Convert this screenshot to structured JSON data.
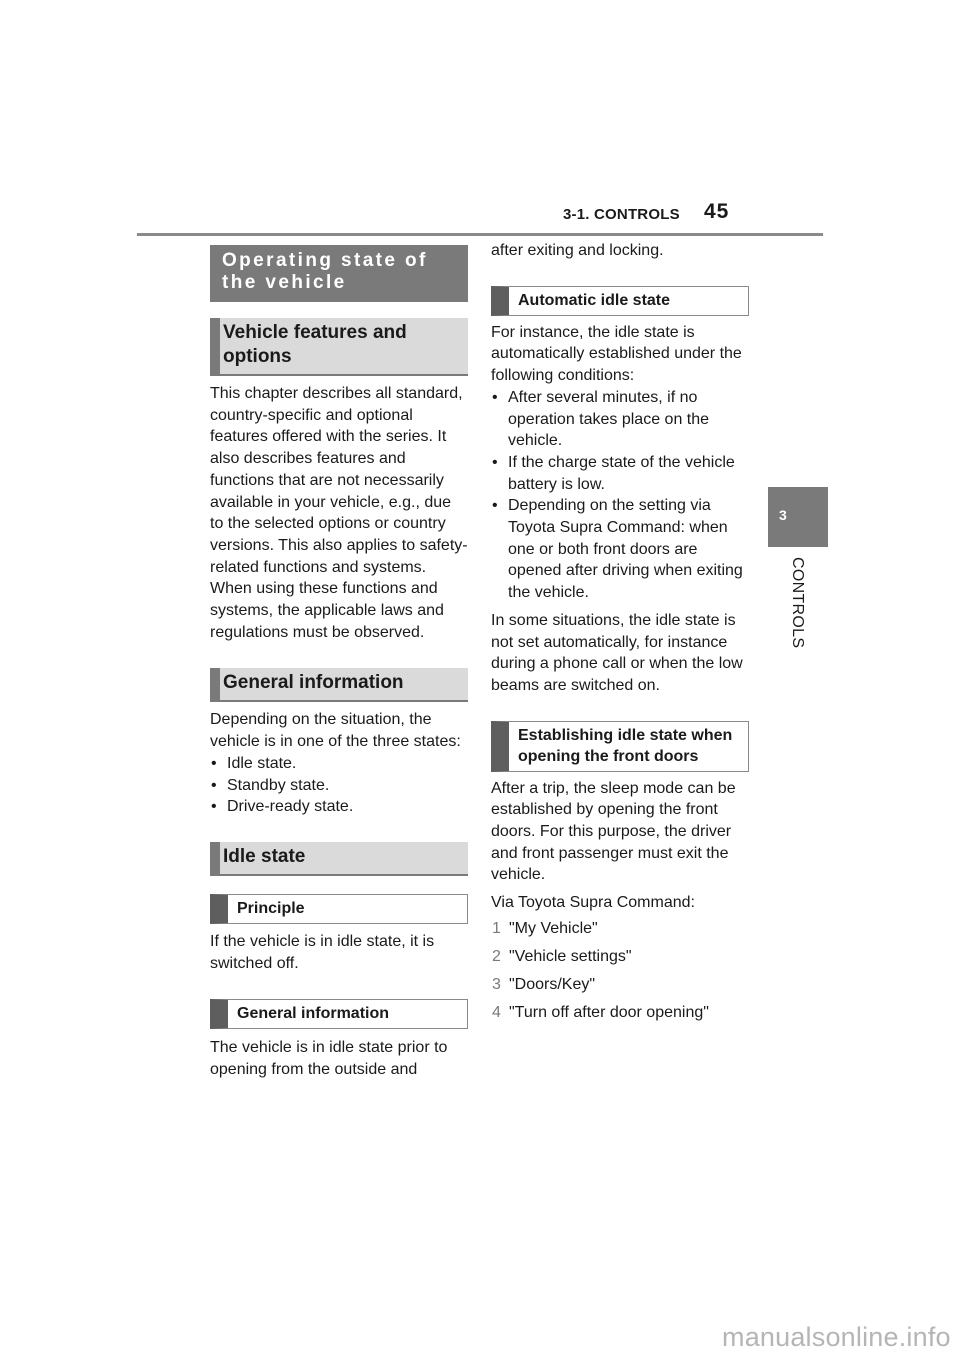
{
  "header": {
    "section": "3-1. CONTROLS",
    "page_number": "45"
  },
  "side_tab": {
    "chapter_number": "3",
    "chapter_label": "CONTROLS"
  },
  "left_column": {
    "title": "Operating state of the vehicle",
    "features_heading": "Vehicle features and options",
    "features_text": "This chapter describes all standard, country-specific and optional features offered with the series. It also describes features and functions that are not necessarily available in your vehicle, e.g., due to the selected options or country versions. This also applies to safety-related functions and systems. When using these functions and systems, the applicable laws and regulations must be observed.",
    "general_heading": "General information",
    "general_text": "Depending on the situation, the vehicle is in one of the three states:",
    "states": [
      "Idle state.",
      "Standby state.",
      "Drive-ready state."
    ],
    "idle_heading": "Idle state",
    "principle_heading": "Principle",
    "principle_text": "If the vehicle is in idle state, it is switched off.",
    "idle_general_heading": "General information",
    "idle_general_text": "The vehicle is in idle state prior to opening from the outside and"
  },
  "right_column": {
    "continued_text": "after exiting and locking.",
    "auto_heading": "Automatic idle state",
    "auto_intro": "For instance, the idle state is automatically established under the following conditions:",
    "auto_conditions": [
      "After several minutes, if no operation takes place on the vehicle.",
      "If the charge state of the vehicle battery is low.",
      "Depending on the setting via Toyota Supra Command: when one or both front doors are opened after driving when exiting the vehicle."
    ],
    "auto_note": "In some situations, the idle state is not set automatically, for instance during a phone call or when the low beams are switched on.",
    "doors_heading": "Establishing idle state when opening the front doors",
    "doors_text": "After a trip, the sleep mode can be established by opening the front doors. For this purpose, the driver and front passenger must exit the vehicle.",
    "via_text": "Via Toyota Supra Command:",
    "steps": [
      {
        "number": "1",
        "label": "\"My Vehicle\""
      },
      {
        "number": "2",
        "label": "\"Vehicle settings\""
      },
      {
        "number": "3",
        "label": "\"Doors/Key\""
      },
      {
        "number": "4",
        "label": "\"Turn off after door opening\""
      }
    ]
  },
  "footer": {
    "watermark": "manualsonline.info"
  }
}
